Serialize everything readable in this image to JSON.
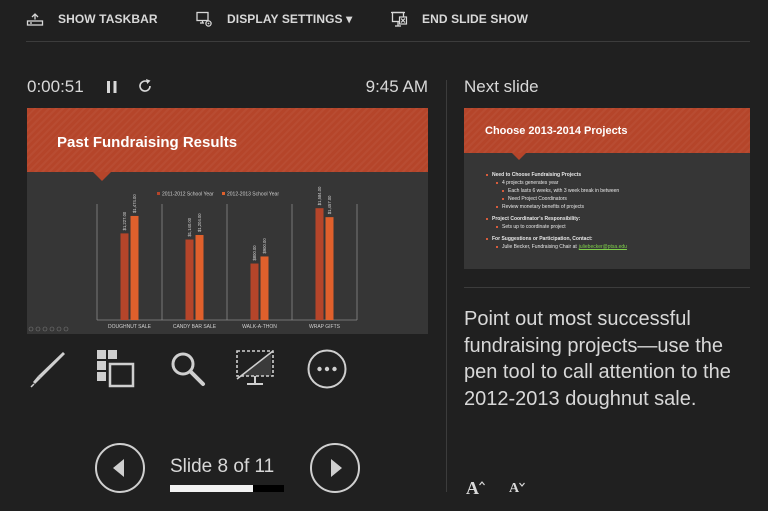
{
  "toolbar": {
    "show_taskbar": "SHOW TASKBAR",
    "display_settings": "DISPLAY SETTINGS ▾",
    "end_slide_show": "END SLIDE SHOW",
    "icons": [
      "taskbar-icon",
      "display-settings-icon",
      "end-show-icon"
    ]
  },
  "timer": {
    "elapsed": "0:00:51",
    "clock": "9:45 AM"
  },
  "current_slide": {
    "title": "Past Fundraising Results",
    "chart_data": {
      "type": "bar",
      "categories": [
        "DOUGHNUT SALE",
        "CANDY BAR SALE",
        "WALK-A-THON",
        "WRAP GIFTS"
      ],
      "series": [
        {
          "name": "2011-2012 School Year",
          "values": [
            1227,
            1140,
            800,
            1584
          ],
          "color": "#b5452a",
          "labels": [
            "$1,227.00",
            "$1,140.00",
            "$800.00",
            "$1,584.00"
          ]
        },
        {
          "name": "2012-2013 School Year",
          "values": [
            1474,
            1204,
            900,
            1457
          ],
          "color": "#e0602c",
          "labels": [
            "$1,474.00",
            "$1,204.00",
            "$900.00",
            "$1,457.00"
          ]
        }
      ],
      "ylim": [
        0,
        1700
      ]
    }
  },
  "navigation": {
    "slide_count": "Slide 8 of 11",
    "progress": 0.727
  },
  "next_slide": {
    "label": "Next slide",
    "title": "Choose 2013-2014 Projects",
    "bullets": [
      {
        "level": 1,
        "text": "Need to Choose Fundraising Projects"
      },
      {
        "level": 2,
        "text": "4 projects generates year"
      },
      {
        "level": 3,
        "text": "Each lasts 6 weeks, with 3 week break in between"
      },
      {
        "level": 3,
        "text": "Need Project Coordinators"
      },
      {
        "level": 2,
        "text": "Review monetary benefits of projects"
      },
      {
        "level": 1,
        "text": "Project Coordinator’s Responsibility:",
        "gap": true
      },
      {
        "level": 2,
        "text": "Sets up to coordinate project"
      },
      {
        "level": 1,
        "text": "For Suggestions or Participation, Contact:",
        "gap": true
      },
      {
        "level": 2,
        "text": "Julie Becker, Fundraising Chair at",
        "link": "juliebecker@ptsa.edu"
      }
    ]
  },
  "notes": {
    "text": "Point out most successful fundraising projects—use the pen tool to call attention to the 2012-2013 doughnut sale."
  },
  "font_controls": {
    "increase": "A",
    "decrease": "A"
  }
}
